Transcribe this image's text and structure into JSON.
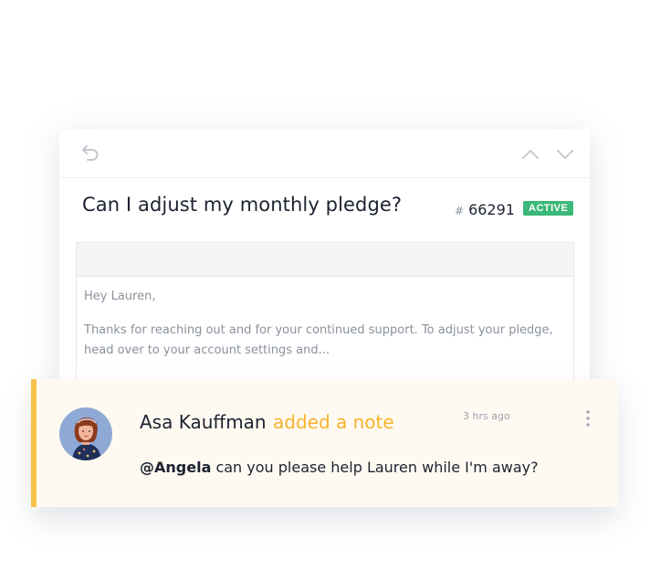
{
  "ticket": {
    "subject": "Can I adjust my monthly pledge?",
    "number_prefix": "#",
    "number": "66291",
    "status": "ACTIVE",
    "status_color": "#3cb878",
    "toolbar": {
      "back_icon": "undo-arrow-icon",
      "prev_icon": "chevron-up-icon",
      "next_icon": "chevron-down-icon"
    },
    "message": {
      "greeting": "Hey Lauren,",
      "body": "Thanks for reaching out and  for your continued support. To adjust your pledge, head over to your account settings and..."
    }
  },
  "note": {
    "author": "Asa Kauffman",
    "action": "added a note",
    "time": "3 hrs ago",
    "mention": "@Angela",
    "text": " can you please help Lauren while I'm away?",
    "accent_color": "#f8c14b",
    "action_color": "#f5b32e",
    "menu_icon": "more-vertical-icon"
  }
}
